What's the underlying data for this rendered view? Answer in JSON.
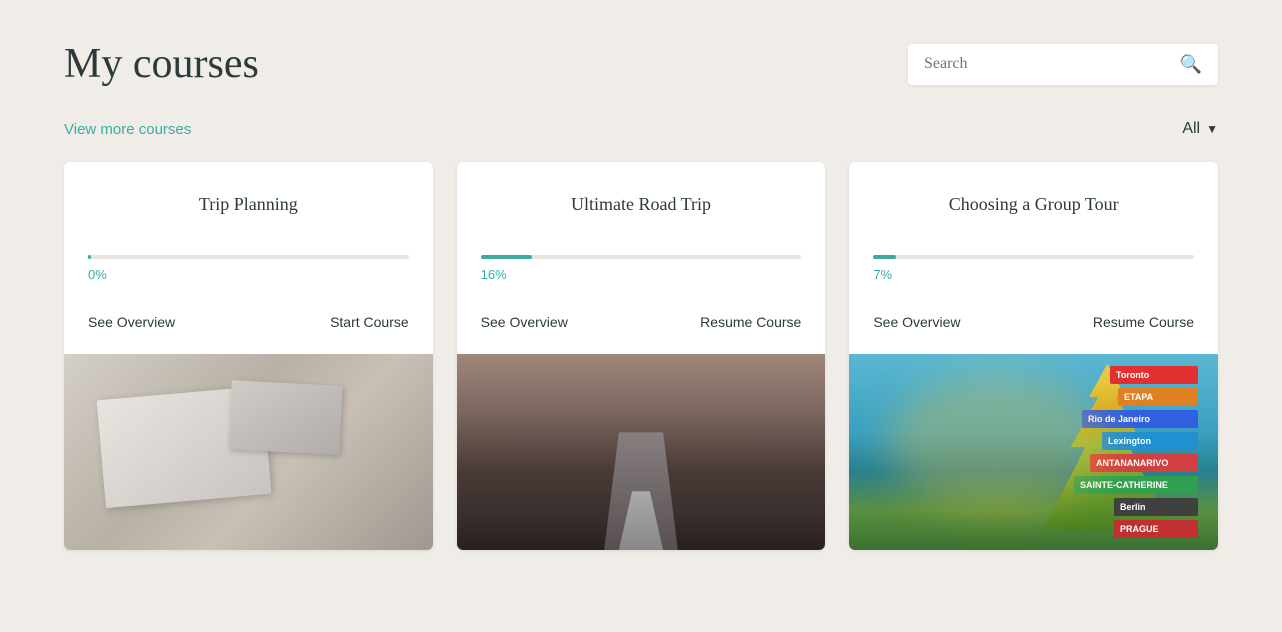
{
  "header": {
    "title": "My courses",
    "search_placeholder": "Search"
  },
  "subheader": {
    "view_more_label": "View more courses",
    "filter_label": "All"
  },
  "courses": [
    {
      "id": "trip-planning",
      "title": "Trip Planning",
      "progress_pct": 0,
      "progress_label": "0%",
      "action1": "See Overview",
      "action2": "Start Course",
      "image_class": "img-trip-planning"
    },
    {
      "id": "ultimate-road-trip",
      "title": "Ultimate Road Trip",
      "progress_pct": 16,
      "progress_label": "16%",
      "action1": "See Overview",
      "action2": "Resume Course",
      "image_class": "img-road-trip"
    },
    {
      "id": "choosing-group-tour",
      "title": "Choosing a Group Tour",
      "progress_pct": 7,
      "progress_label": "7%",
      "action1": "See Overview",
      "action2": "Resume Course",
      "image_class": "img-group-tour"
    }
  ],
  "colors": {
    "accent": "#3aada0",
    "text_dark": "#2c3a3a",
    "bg": "#f0ece8"
  }
}
